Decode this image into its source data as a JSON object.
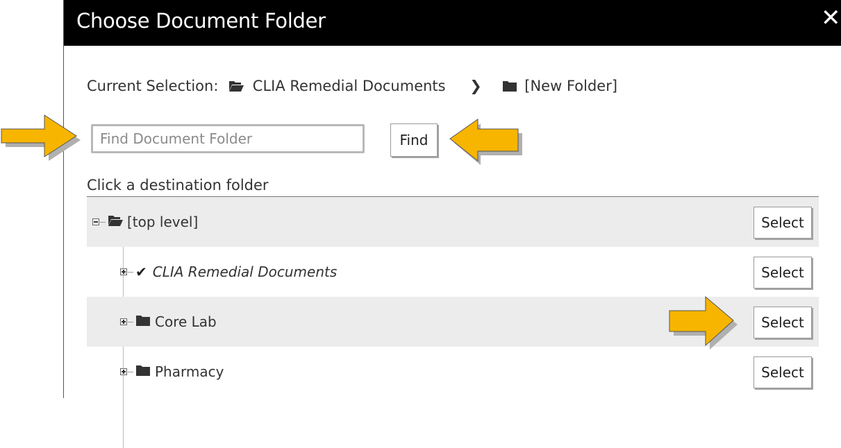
{
  "dialog": {
    "title": "Choose Document Folder",
    "close_icon": "close-icon",
    "close_label": "✕"
  },
  "current_selection": {
    "label": "Current Selection:",
    "path": [
      {
        "name": "CLIA Remedial Documents",
        "icon": "folder-open-icon"
      },
      {
        "name": "[New Folder]",
        "icon": "folder-icon"
      }
    ],
    "separator": "❯"
  },
  "search": {
    "placeholder": "Find Document Folder",
    "value": "",
    "button_label": "Find"
  },
  "tree": {
    "heading": "Click a destination folder",
    "rows": [
      {
        "label": "[top level]",
        "icon": "folder-open-icon",
        "expander": "minus",
        "select_label": "Select"
      },
      {
        "label": "CLIA Remedial Documents",
        "icon": "check-icon",
        "expander": "plus",
        "select_label": "Select"
      },
      {
        "label": "Core Lab",
        "icon": "folder-icon",
        "expander": "plus",
        "select_label": "Select"
      },
      {
        "label": "Pharmacy",
        "icon": "folder-icon",
        "expander": "plus",
        "select_label": "Select"
      }
    ]
  },
  "annotation_arrows": {
    "color": "#F7B500",
    "outline": "#555555",
    "shadow": "#b0b0b0",
    "targets": [
      "search-input",
      "find-button",
      "select-core-lab"
    ]
  },
  "colors": {
    "titlebar": "#000000",
    "row_shade": "#ececec",
    "text": "#333333"
  }
}
